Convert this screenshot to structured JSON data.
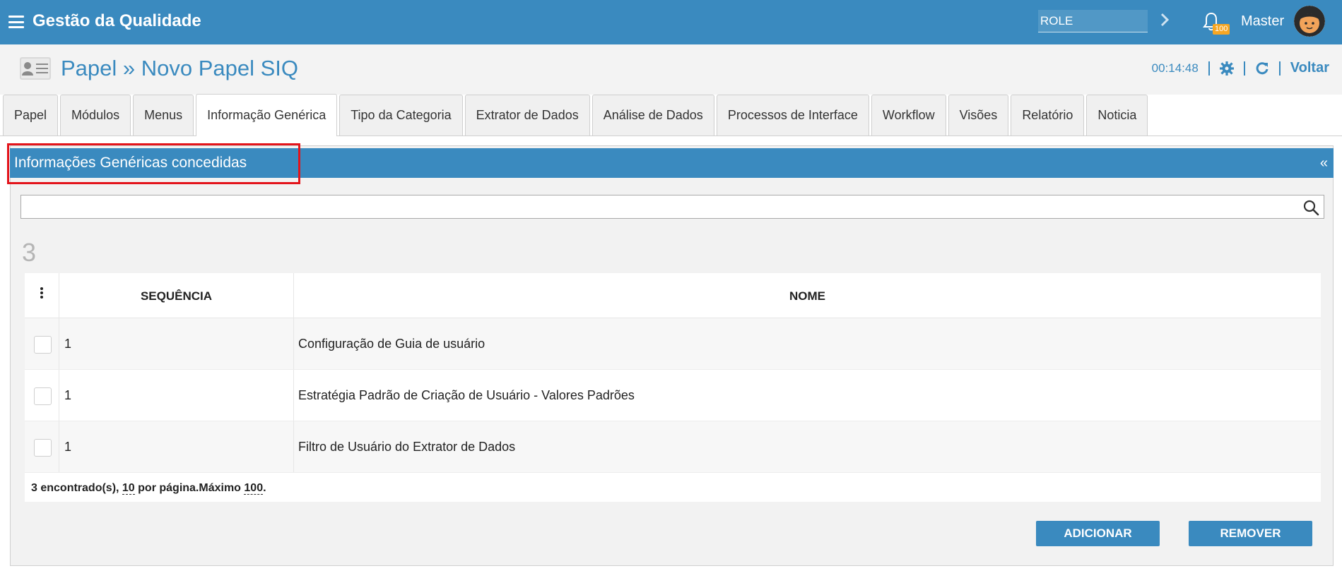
{
  "topbar": {
    "app_title": "Gestão da Qualidade",
    "role_value": "ROLE",
    "notification_count": "100",
    "user_name": "Master",
    "colors": {
      "bar": "#3a8abf",
      "badge": "#f6a623"
    }
  },
  "page": {
    "title": "Papel » Novo Papel SIQ",
    "timer": "00:14:48",
    "back_label": "Voltar"
  },
  "tabs": [
    {
      "label": "Papel",
      "active": false
    },
    {
      "label": "Módulos",
      "active": false
    },
    {
      "label": "Menus",
      "active": false
    },
    {
      "label": "Informação Genérica",
      "active": true
    },
    {
      "label": "Tipo da Categoria",
      "active": false
    },
    {
      "label": "Extrator de Dados",
      "active": false
    },
    {
      "label": "Análise de Dados",
      "active": false
    },
    {
      "label": "Processos de Interface",
      "active": false
    },
    {
      "label": "Workflow",
      "active": false
    },
    {
      "label": "Visões",
      "active": false
    },
    {
      "label": "Relatório",
      "active": false
    },
    {
      "label": "Noticia",
      "active": false
    }
  ],
  "panel": {
    "title": "Informações Genéricas concedidas",
    "collapse_icon": "«",
    "search_value": "",
    "result_count": "3",
    "highlight_color": "#e3141b"
  },
  "table": {
    "headers": {
      "sequence": "SEQUÊNCIA",
      "name": "NOME"
    },
    "rows": [
      {
        "sequence": "1",
        "name": "Configuração de Guia de usuário"
      },
      {
        "sequence": "1",
        "name": "Estratégia Padrão de Criação de Usuário - Valores Padrões"
      },
      {
        "sequence": "1",
        "name": "Filtro de Usuário do Extrator de Dados"
      }
    ],
    "footer": {
      "found_text": "3 encontrado(s), ",
      "per_page_value": "10",
      "per_page_text": " por página.Máximo ",
      "max_value": "100",
      "end_text": "."
    }
  },
  "actions": {
    "add_label": "ADICIONAR",
    "remove_label": "REMOVER"
  }
}
